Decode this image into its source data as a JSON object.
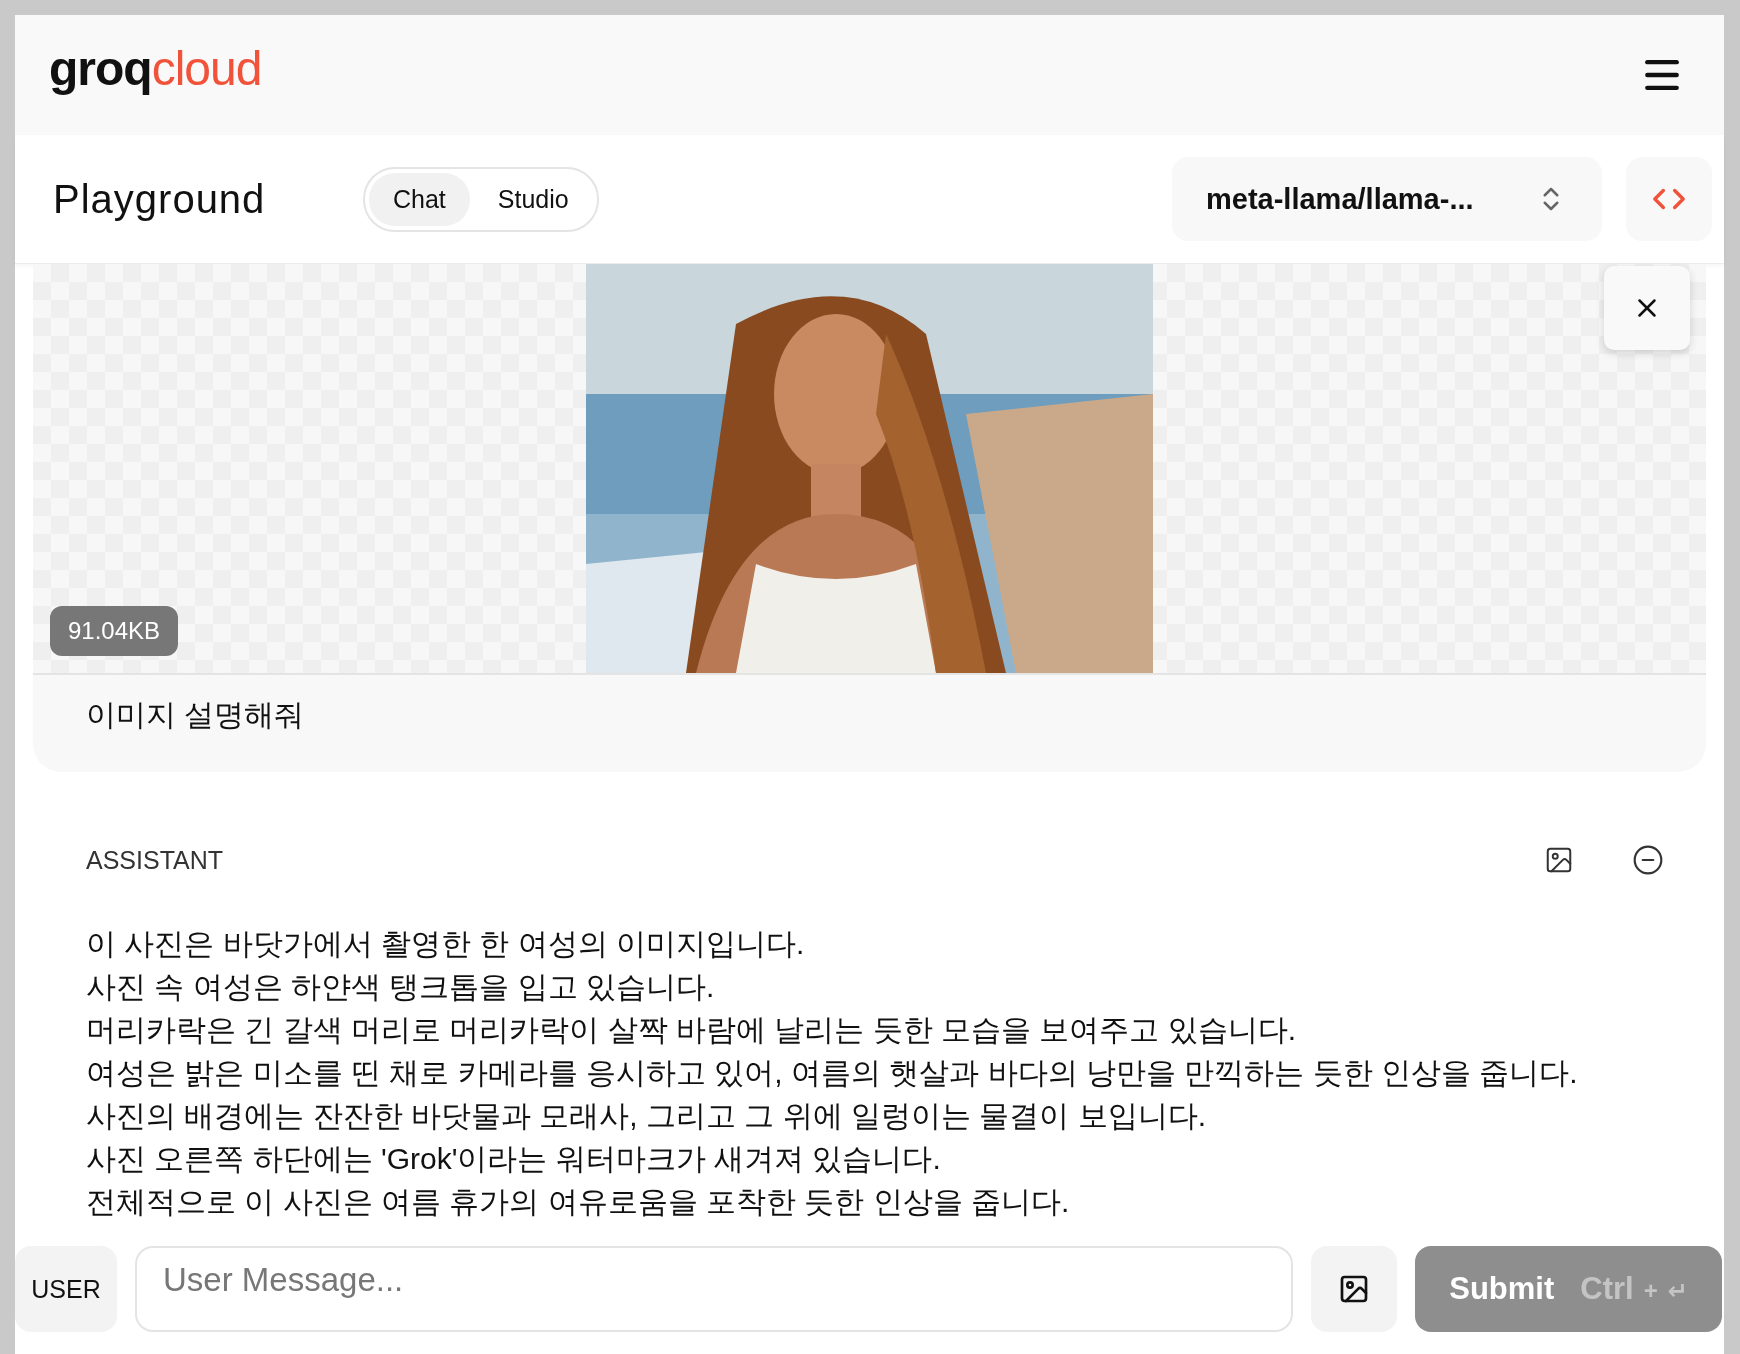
{
  "header": {
    "logo": {
      "part_1": "groq",
      "part_2": "cloud"
    }
  },
  "toolbar": {
    "title": "Playground",
    "tabs": [
      {
        "label": "Chat",
        "selected": true
      },
      {
        "label": "Studio",
        "selected": false
      }
    ],
    "model": "meta-llama/llama-..."
  },
  "attachment": {
    "size": "91.04KB"
  },
  "user_message": "이미지 설명해줘",
  "assistant": {
    "role": "ASSISTANT",
    "lines": [
      "이 사진은 바닷가에서 촬영한 한 여성의 이미지입니다.",
      "사진 속 여성은 하얀색 탱크톱을 입고 있습니다.",
      "머리카락은 긴 갈색 머리로 머리카락이 살짝 바람에 날리는 듯한 모습을 보여주고 있습니다.",
      "여성은 밝은 미소를 띤 채로 카메라를 응시하고 있어, 여름의 햇살과 바다의 낭만을 만끽하는 듯한 인상을 줍니다.",
      "사진의 배경에는 잔잔한 바닷물과 모래사, 그리고 그 위에 일렁이는 물결이 보입니다.",
      "사진 오른쪽 하단에는 'Grok'이라는 워터마크가 새겨져 있습니다.",
      "전체적으로 이 사진은 여름 휴가의 여유로움을 포착한 듯한 인상을 줍니다."
    ]
  },
  "composer": {
    "role": "USER",
    "placeholder": "User Message...",
    "submit": {
      "label": "Submit",
      "shortcut_key": "Ctrl",
      "plus": "+",
      "enter_symbol": "↵",
      "disabled": true
    }
  }
}
